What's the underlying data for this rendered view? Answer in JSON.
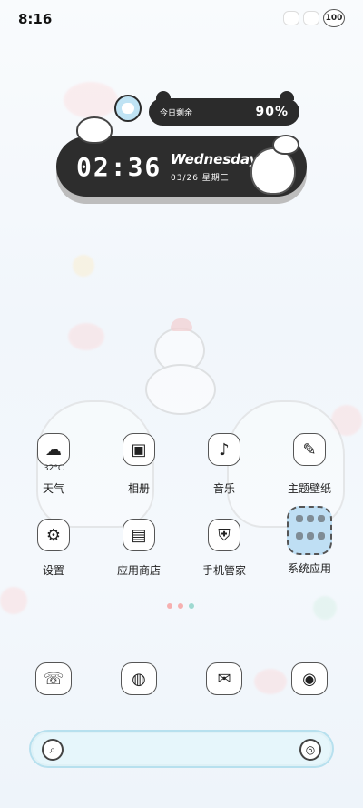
{
  "status": {
    "time": "8:16",
    "battery": "100"
  },
  "widget": {
    "pill_label": "今日剩余",
    "pill_percent": "90%",
    "time": "02:36",
    "weekday": "Wednesday",
    "date": "03/26  星期三"
  },
  "apps": [
    {
      "label": "天气",
      "sub": "32°C",
      "icon": "weather-icon"
    },
    {
      "label": "相册",
      "icon": "gallery-icon"
    },
    {
      "label": "音乐",
      "icon": "music-icon"
    },
    {
      "label": "主题壁纸",
      "icon": "theme-icon"
    },
    {
      "label": "设置",
      "icon": "settings-icon"
    },
    {
      "label": "应用商店",
      "icon": "app-store-icon"
    },
    {
      "label": "手机管家",
      "icon": "phone-manager-icon"
    },
    {
      "label": "系统应用",
      "icon": "folder-icon"
    }
  ],
  "dock": [
    {
      "icon": "phone-icon"
    },
    {
      "icon": "browser-icon"
    },
    {
      "icon": "messages-icon"
    },
    {
      "icon": "camera-icon"
    }
  ],
  "colors": {
    "widget_dark": "#2d2d2d",
    "folder": "#bfdff4",
    "search_border": "#b7e0ee"
  }
}
